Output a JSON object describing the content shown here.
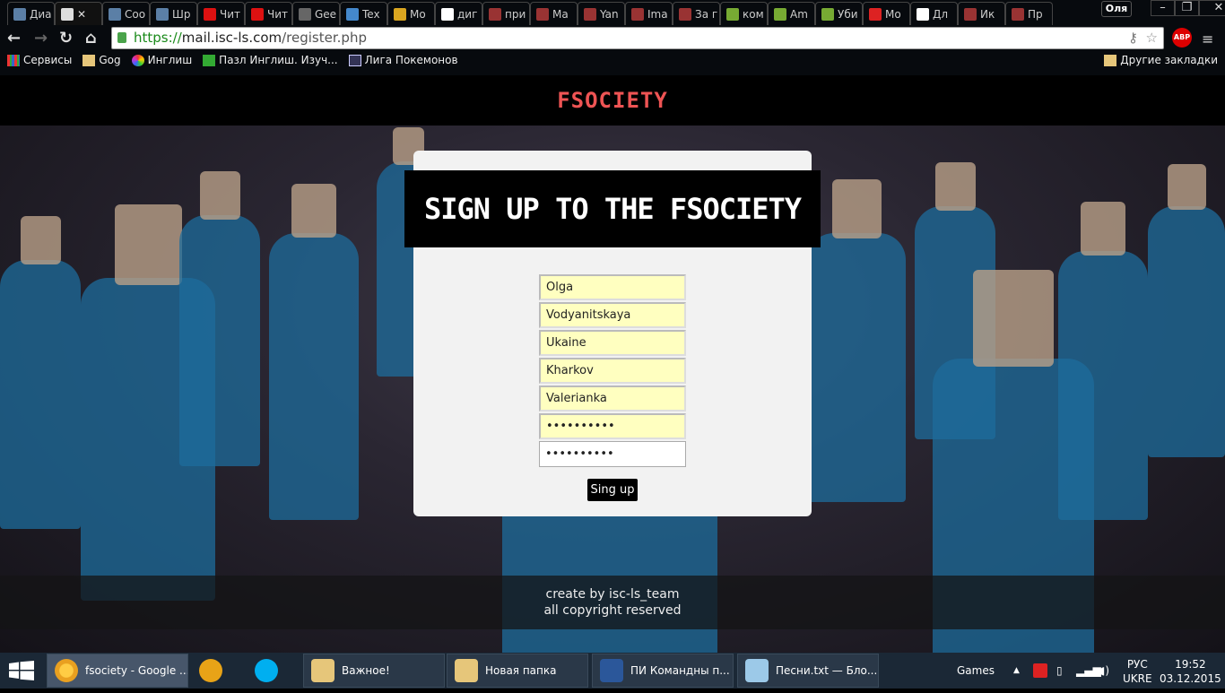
{
  "browser": {
    "tabs": [
      "Диа",
      "",
      "Соо",
      "Шр",
      "Чит",
      "Чит",
      "Gee",
      "Tex",
      "Мо",
      "диг",
      "при",
      "Ма",
      "Yan",
      "Ima",
      "За г",
      "ком",
      "Am",
      "Уби",
      "Мо",
      "Дл",
      "Ик",
      "Пр"
    ],
    "active_tab_index": 1,
    "user": "Оля",
    "url_scheme": "https://",
    "url_host": "mail.isc-ls.com",
    "url_path": "/register.php",
    "abp": "ABP",
    "bookmarks": [
      "Сервисы",
      "Gog",
      "Инглиш",
      "Пазл Инглиш. Изуч...",
      "Лига Покемонов"
    ],
    "other_bookmarks": "Другие закладки"
  },
  "page": {
    "brand": "FSOCIETY",
    "card_title": "SIGN UP TO THE FSOCIETY",
    "fields": [
      "Olga",
      "Vodyanitskaya",
      "Ukaine",
      "Kharkov",
      "Valerianka",
      "••••••••••",
      "••••••••••"
    ],
    "submit": "Sing up",
    "footer_line1": "create by isc-ls_team",
    "footer_line2": "all copyright reserved"
  },
  "taskbar": {
    "items": [
      "fsociety - Google ...",
      "",
      "",
      "Важное!",
      "Новая папка",
      "ПИ Командны п...",
      "Песни.txt — Бло..."
    ],
    "games": "Games",
    "lang1": "РУС",
    "lang2": "UKRE",
    "time": "19:52",
    "date": "03.12.2015"
  },
  "colors": {
    "brand": "#ee5454",
    "field_bg": "#ffffc0",
    "taskbar": "#1b2836"
  }
}
